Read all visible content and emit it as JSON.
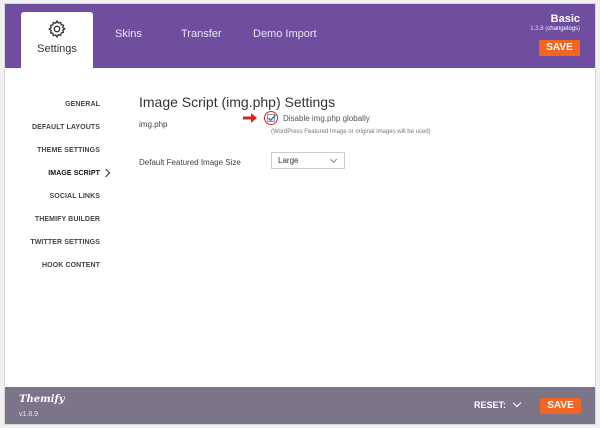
{
  "header": {
    "tabs": [
      {
        "label": "Settings",
        "icon": "gear-icon",
        "active": true
      },
      {
        "label": "Skins"
      },
      {
        "label": "Transfer"
      },
      {
        "label": "Demo Import"
      }
    ],
    "theme_name": "Basic",
    "version_prefix": "1.3.8 (",
    "changelog_label": "changelogs",
    "version_suffix": ")",
    "save_label": "SAVE"
  },
  "sidebar": {
    "items": [
      {
        "label": "GENERAL"
      },
      {
        "label": "DEFAULT LAYOUTS"
      },
      {
        "label": "THEME SETTINGS"
      },
      {
        "label": "IMAGE SCRIPT",
        "active": true
      },
      {
        "label": "SOCIAL LINKS"
      },
      {
        "label": "THEMIFY BUILDER"
      },
      {
        "label": "TWITTER SETTINGS"
      },
      {
        "label": "HOOK CONTENT"
      }
    ]
  },
  "main": {
    "title": "Image Script (img.php) Settings",
    "imgphp_label": "img.php",
    "disable_checkbox": {
      "label": "Disable img.php globally",
      "checked": true
    },
    "help_text": "(WordPress Featured Image or original images will be used)",
    "featured_size_label": "Default Featured Image Size",
    "featured_size_value": "Large"
  },
  "footer": {
    "brand": "Themify",
    "version": "v1.8.9",
    "reset_label": "RESET:",
    "save_label": "SAVE"
  },
  "colors": {
    "header_bg": "#6f4ea0",
    "footer_bg": "#7c7488",
    "accent": "#f26522",
    "highlight": "#d9261c"
  }
}
